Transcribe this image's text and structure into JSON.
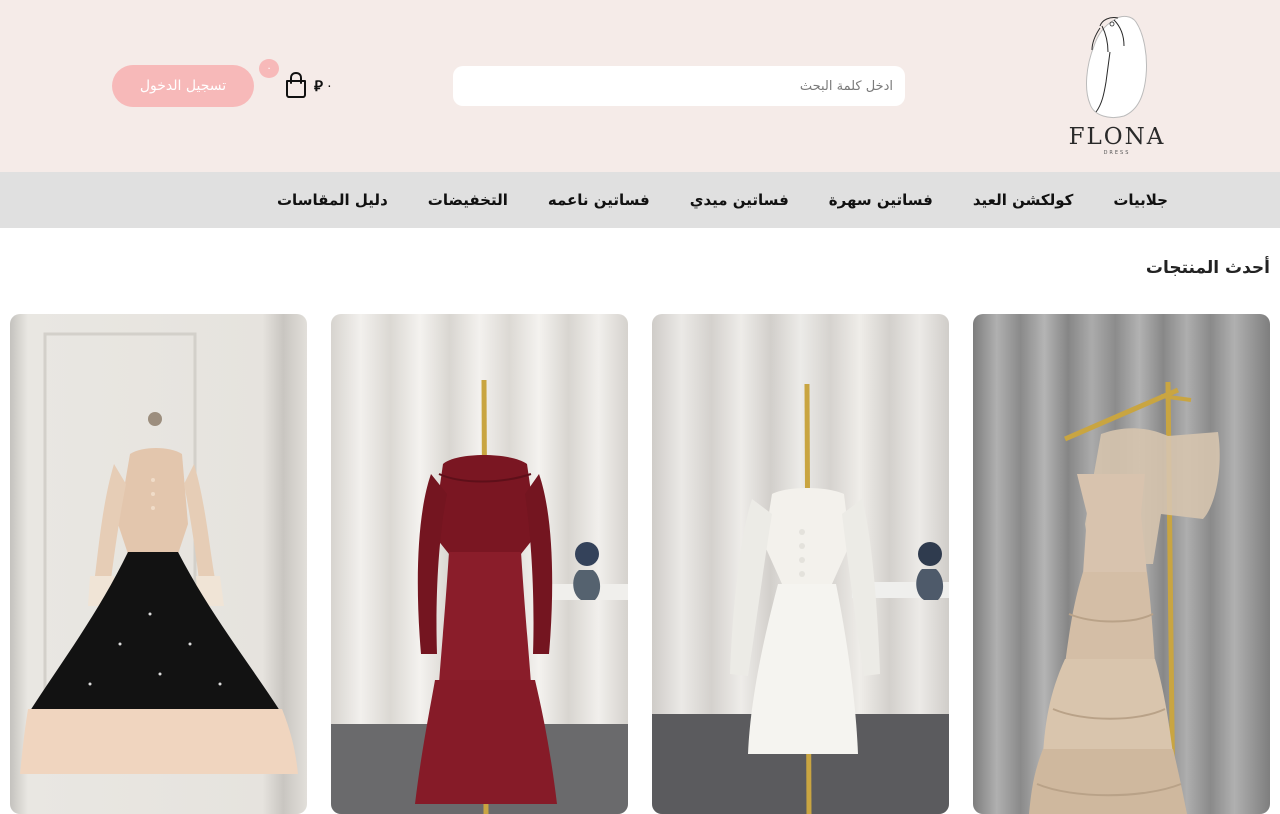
{
  "header": {
    "logo": {
      "text": "FLONA",
      "subtext": "DRESS"
    },
    "search": {
      "placeholder": "ادخل كلمة البحث",
      "value": ""
    },
    "cart": {
      "amount": "٠",
      "currency_symbol": "⃁",
      "count": "٠"
    },
    "login_label": "تسجيل الدخول",
    "colors": {
      "header_bg": "#f5ebe8",
      "accent_pink": "#f7b9b9",
      "nav_bg": "#e0e0e0"
    }
  },
  "nav": {
    "items": [
      {
        "label": "جلابيات"
      },
      {
        "label": "كولكشن العيد"
      },
      {
        "label": "فساتين سهرة"
      },
      {
        "label": "فساتين ميدي"
      },
      {
        "label": "فساتين ناعمه"
      },
      {
        "label": "التخفيضات"
      },
      {
        "label": "دليل المقاسات"
      }
    ]
  },
  "main": {
    "section_title": "أحدث المنتجات",
    "products": [
      {
        "icon": "champagne-tiered-dress-image",
        "dress_color": "#d8c3ae",
        "curtain": "#9a9a9a"
      },
      {
        "icon": "white-puff-sleeve-dress-image",
        "dress_color": "#f2f0ec",
        "curtain": "#d9d6d2"
      },
      {
        "icon": "burgundy-lace-dress-image",
        "dress_color": "#8a1d2a",
        "curtain": "#e8e6e2"
      },
      {
        "icon": "black-peach-lace-dress-image",
        "dress_color": "#111111",
        "curtain": "#e6e3de"
      }
    ]
  }
}
